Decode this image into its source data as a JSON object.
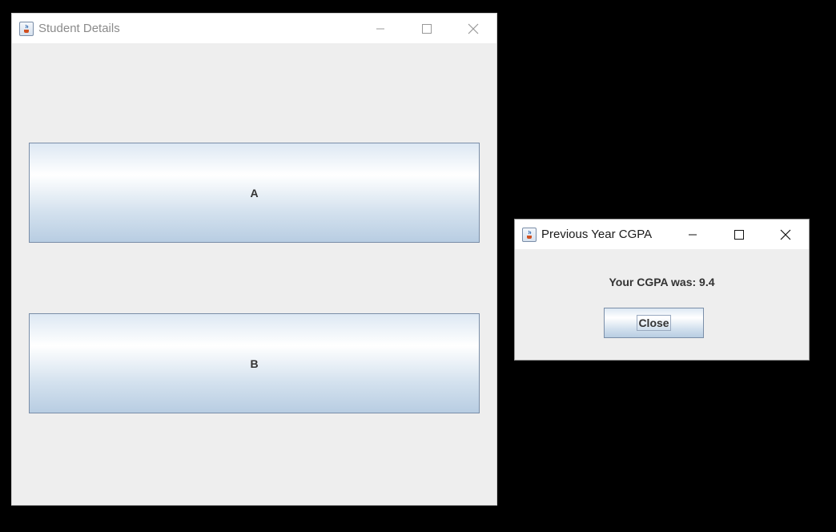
{
  "main_window": {
    "title": "Student Details",
    "buttons": [
      {
        "label": "A"
      },
      {
        "label": "B"
      }
    ]
  },
  "dialog": {
    "title": "Previous Year CGPA",
    "message": "Your CGPA was: 9.4",
    "close_label": "Close"
  },
  "icons": {
    "app": "java-app-icon",
    "minimize": "minimize-icon",
    "maximize": "maximize-icon",
    "close": "close-icon"
  },
  "colors": {
    "desktop": "#000000",
    "window_bg": "#eeeeee",
    "titlebar_bg": "#ffffff",
    "button_border": "#7a8ea8",
    "button_gradient_bottom": "#b8cde2"
  }
}
